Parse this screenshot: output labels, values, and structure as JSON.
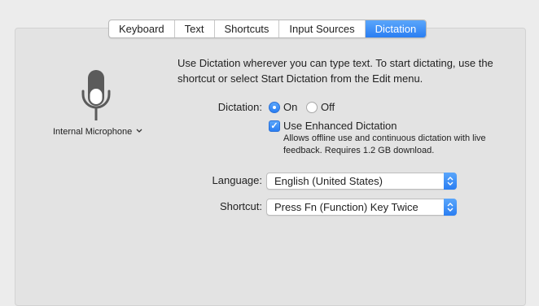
{
  "tabs": [
    "Keyboard",
    "Text",
    "Shortcuts",
    "Input Sources",
    "Dictation"
  ],
  "active_tab": "Dictation",
  "mic": {
    "label": "Internal Microphone"
  },
  "intro_text": "Use Dictation wherever you can type text. To start dictating, use the shortcut or select Start Dictation from the Edit menu.",
  "dictation": {
    "label": "Dictation:",
    "on_label": "On",
    "off_label": "Off",
    "selected": "On"
  },
  "enhanced": {
    "label": "Use Enhanced Dictation",
    "checked": true,
    "note": "Allows offline use and continuous dictation with live feedback. Requires 1.2 GB download."
  },
  "language": {
    "label": "Language:",
    "value": "English (United States)"
  },
  "shortcut": {
    "label": "Shortcut:",
    "value": "Press Fn (Function) Key Twice"
  },
  "colors": {
    "accent": "#2a7ef2",
    "panel": "#e3e3e3"
  }
}
